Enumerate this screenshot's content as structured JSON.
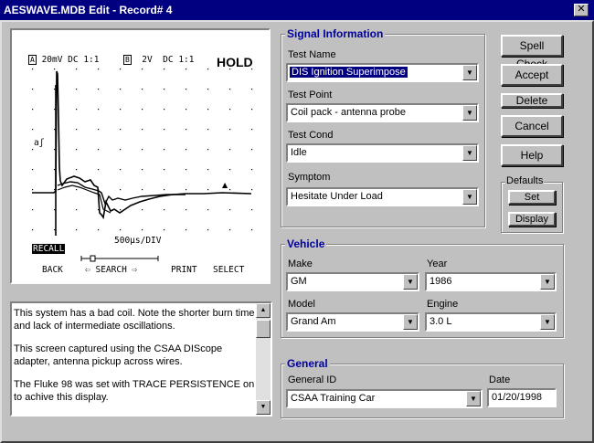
{
  "window": {
    "title": "AESWAVE.MDB  Edit - Record# 4",
    "close_label": "✕"
  },
  "scope": {
    "ch_a": "20mV DC 1:1",
    "ch_b": "2V  DC 1:1",
    "hold": "HOLD",
    "trigger_marker": "aʃ",
    "timebase": "500µs/DIV",
    "recall": "RECALL",
    "softkeys": [
      "BACK",
      "SEARCH",
      "PRINT",
      "SELECT"
    ]
  },
  "notes": {
    "paragraphs": [
      "This system has a bad coil. Note the shorter  burn time and lack of intermediate oscillations.",
      "This screen captured using the CSAA DIScope adapter, antenna pickup across wires.",
      "The Fluke 98 was set with TRACE PERSISTENCE on to achive this display."
    ]
  },
  "signal": {
    "title": "Signal Information",
    "test_name": {
      "label": "Test Name",
      "value": "DIS Ignition Superimpose"
    },
    "test_point": {
      "label": "Test Point",
      "value": "Coil pack - antenna probe"
    },
    "test_cond": {
      "label": "Test Cond",
      "value": "Idle"
    },
    "symptom": {
      "label": "Symptom",
      "value": "Hesitate Under Load"
    }
  },
  "buttons": {
    "spell_check": "Spell Check",
    "accept": "Accept",
    "delete": "Delete",
    "cancel": "Cancel",
    "help": "Help"
  },
  "defaults": {
    "title": "Defaults",
    "set": "Set",
    "display": "Display"
  },
  "vehicle": {
    "title": "Vehicle",
    "make": {
      "label": "Make",
      "value": "GM"
    },
    "year": {
      "label": "Year",
      "value": "1986"
    },
    "model": {
      "label": "Model",
      "value": "Grand Am"
    },
    "engine": {
      "label": "Engine",
      "value": "3.0 L"
    }
  },
  "general": {
    "title": "General",
    "general_id": {
      "label": "General ID",
      "value": "CSAA Training Car"
    },
    "date": {
      "label": "Date",
      "value": "01/20/1998"
    }
  }
}
